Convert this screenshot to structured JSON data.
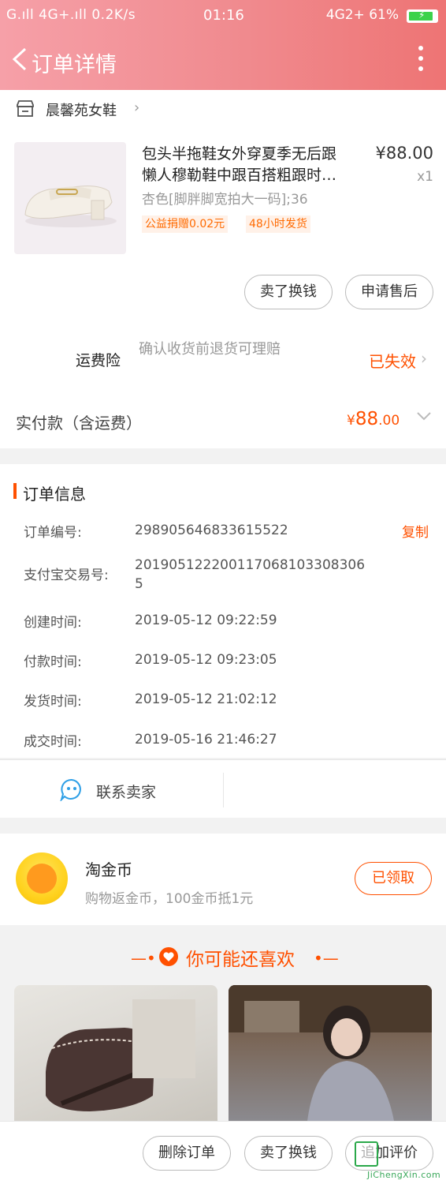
{
  "status_bar": {
    "left": "G.ıll 4G+.ıll 0.2K/s",
    "time": "01:16",
    "right": "4G2+ 61%"
  },
  "nav": {
    "title": "订单详情"
  },
  "shop": {
    "name": "晨馨苑女鞋"
  },
  "product": {
    "title_line1": "包头半拖鞋女外穿夏季无后跟",
    "title_line2": "懒人穆勒鞋中跟百搭粗跟时…",
    "price": "¥88.00",
    "qty": "x1",
    "sku": "杏色[脚胖脚宽拍大一码];36",
    "tag_charity": "公益捐赠0.02元",
    "tag_ship": "48小时发货"
  },
  "actions": {
    "sell_label": "卖了换钱",
    "aftersale_label": "申请售后"
  },
  "insurance": {
    "label": "运费险",
    "desc": "确认收货前退货可理赔",
    "status": "已失效"
  },
  "payment": {
    "label": "实付款（含运费）",
    "currency": "¥",
    "amount_main": "88",
    "amount_decimal": ".00"
  },
  "order_info": {
    "title": "订单信息",
    "rows": [
      {
        "key": "订单编号:",
        "value": "298905646833615522"
      },
      {
        "key": "支付宝交易号:",
        "value": "2019051222001170681033083065"
      },
      {
        "key": "创建时间:",
        "value": "2019-05-12 09:22:59"
      },
      {
        "key": "付款时间:",
        "value": "2019-05-12 09:23:05"
      },
      {
        "key": "发货时间:",
        "value": "2019-05-12 21:02:12"
      },
      {
        "key": "成交时间:",
        "value": "2019-05-16 21:46:27"
      }
    ],
    "copy_label": "复制"
  },
  "contact": {
    "label": "联系卖家"
  },
  "coin": {
    "title": "淘金币",
    "subtitle": "购物返金币，100金币抵1元",
    "button": "已领取"
  },
  "recommend": {
    "title": "你可能还喜欢"
  },
  "bottom": {
    "delete_label": "删除订单",
    "sell_label": "卖了换钱",
    "review_label": "追加评价"
  },
  "watermark": {
    "url": "JiChengXin.com"
  },
  "colors": {
    "accent": "#ff5000",
    "header_start": "#f6a0a8",
    "header_end": "#ee7474"
  }
}
